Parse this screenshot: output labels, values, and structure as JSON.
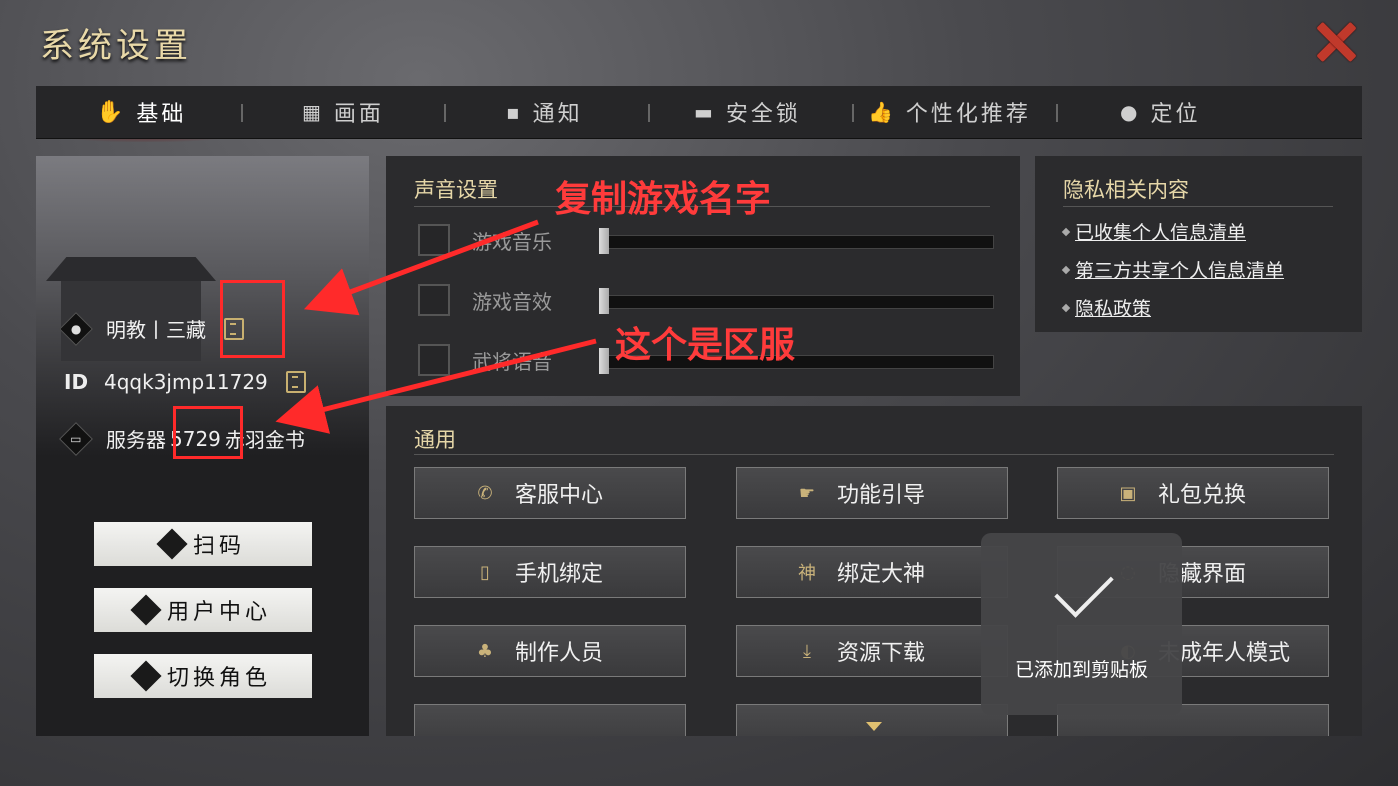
{
  "window": {
    "title": "系统设置"
  },
  "tabs": [
    {
      "label": "基础",
      "icon": "hand-icon"
    },
    {
      "label": "画面",
      "icon": "display-icon"
    },
    {
      "label": "通知",
      "icon": "chat-icon"
    },
    {
      "label": "安全锁",
      "icon": "lock-icon"
    },
    {
      "label": "个性化推荐",
      "icon": "thumbs-icon"
    },
    {
      "label": "定位",
      "icon": "location-pin-icon"
    }
  ],
  "player": {
    "name": "明教丨三藏",
    "id_label": "ID",
    "id": "4qqk3jmp11729",
    "server_prefix": "服务器",
    "server_number": "5729",
    "server_name": "赤羽金书"
  },
  "left_buttons": [
    {
      "label": "扫码"
    },
    {
      "label": "用户中心"
    },
    {
      "label": "切换角色"
    }
  ],
  "sound": {
    "title": "声音设置",
    "rows": [
      {
        "label": "游戏音乐",
        "checked": false,
        "level": 0
      },
      {
        "label": "游戏音效",
        "checked": false,
        "level": 0
      },
      {
        "label": "武将语音",
        "checked": false,
        "level": 0
      }
    ]
  },
  "privacy": {
    "title": "隐私相关内容",
    "links": [
      "已收集个人信息清单",
      "第三方共享个人信息清单",
      "隐私政策"
    ]
  },
  "general": {
    "title": "通用",
    "buttons": [
      {
        "label": "客服中心",
        "icon": "phone-icon"
      },
      {
        "label": "功能引导",
        "icon": "pointing-hand-icon"
      },
      {
        "label": "礼包兑换",
        "icon": "gift-icon"
      },
      {
        "label": "手机绑定",
        "icon": "mobile-icon"
      },
      {
        "label": "绑定大神",
        "icon": "shen-icon",
        "icon_text": "神"
      },
      {
        "label": "隐藏界面",
        "icon": "hide-icon"
      },
      {
        "label": "制作人员",
        "icon": "people-icon"
      },
      {
        "label": "资源下载",
        "icon": "download-icon"
      },
      {
        "label": "未成年人模式",
        "icon": "minor-icon"
      }
    ]
  },
  "toast": {
    "text": "已添加到剪贴板"
  },
  "annotations": {
    "copy_name": "复制游戏名字",
    "server": "这个是区服",
    "color": "#ff2a2a"
  }
}
